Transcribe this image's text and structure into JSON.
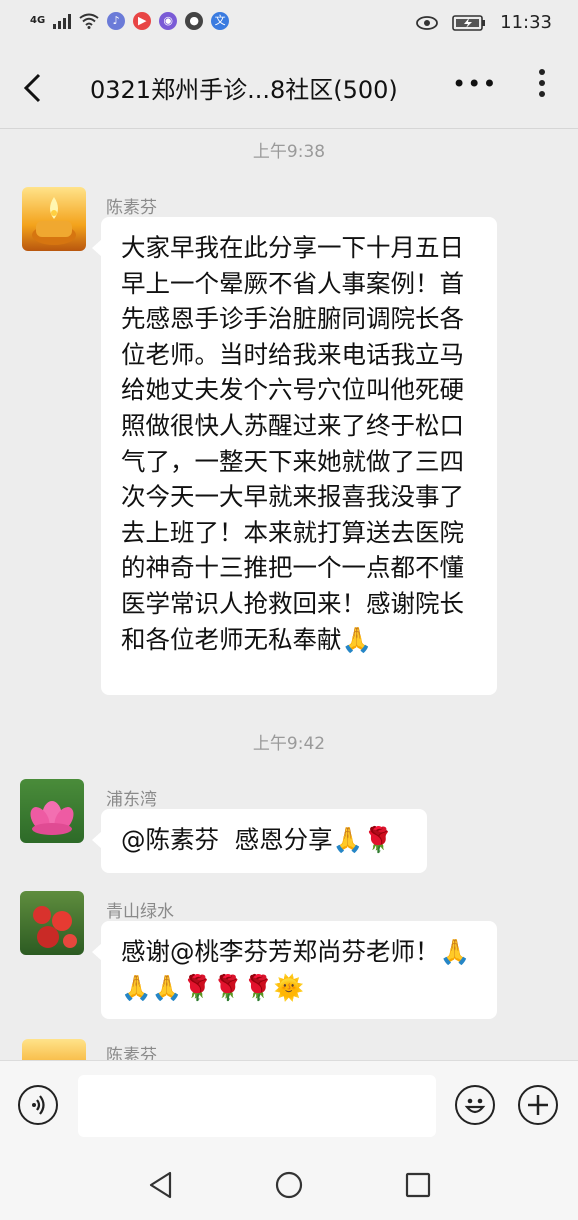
{
  "status": {
    "network": "4G",
    "time": "11:33"
  },
  "header": {
    "title": "0321郑州手诊...8社区(500)",
    "more_label": "•••"
  },
  "messages": [
    {
      "type": "time",
      "text": "上午9:38"
    },
    {
      "type": "msg",
      "sender": "陈素芬",
      "text": "大家早我在此分享一下十月五日早上一个晕厥不省人事案例！首先感恩手诊手治脏腑同调院长各位老师。当时给我来电话我立马给她丈夫发个六号穴位叫他死硬照做很快人苏醒过来了终于松口气了，一整天下来她就做了三四次今天一大早就来报喜我没事了去上班了！本来就打算送去医院的神奇十三推把一个一点都不懂医学常识人抢救回来！感谢院长和各位老师无私奉献🙏"
    },
    {
      "type": "time",
      "text": "上午9:42"
    },
    {
      "type": "msg",
      "sender": "浦东湾",
      "text": "@陈素芬  感恩分享🙏🌹"
    },
    {
      "type": "msg",
      "sender": "青山绿水",
      "text": "感谢@桃李芬芳郑尚芬老师！🙏🙏🙏🌹🌹🌹🌞"
    },
    {
      "type": "msg",
      "sender": "陈素芬",
      "text": ""
    }
  ],
  "icons": {
    "voice": "voice-icon",
    "emoji": "emoji-icon",
    "add": "add-icon",
    "nav_back": "nav-back-icon",
    "nav_home": "nav-home-icon",
    "nav_recent": "nav-recent-icon"
  }
}
